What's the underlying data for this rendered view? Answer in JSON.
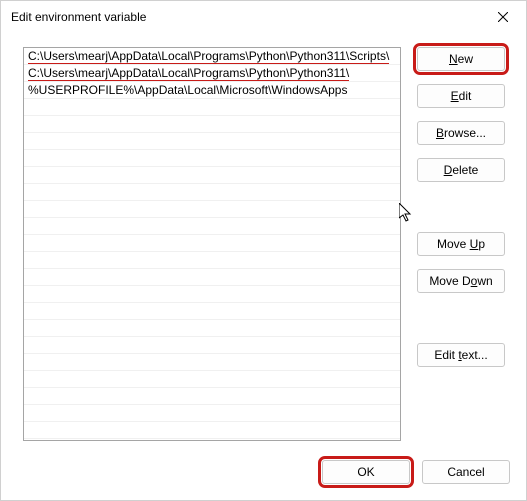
{
  "title": "Edit environment variable",
  "list": {
    "items": [
      "C:\\Users\\mearj\\AppData\\Local\\Programs\\Python\\Python311\\Scripts\\",
      "C:\\Users\\mearj\\AppData\\Local\\Programs\\Python\\Python311\\",
      "%USERPROFILE%\\AppData\\Local\\Microsoft\\WindowsApps"
    ]
  },
  "buttons": {
    "new_u": "N",
    "new_rest": "ew",
    "edit_u": "E",
    "edit_rest": "dit",
    "browse_u": "B",
    "browse_rest": "rowse...",
    "delete_u": "D",
    "delete_rest": "elete",
    "moveup_pre": "Move ",
    "moveup_u": "U",
    "moveup_rest": "p",
    "movedown_pre": "Move D",
    "movedown_u": "o",
    "movedown_rest": "wn",
    "edittext_pre": "Edit ",
    "edittext_u": "t",
    "edittext_rest": "ext...",
    "ok": "OK",
    "cancel": "Cancel"
  }
}
